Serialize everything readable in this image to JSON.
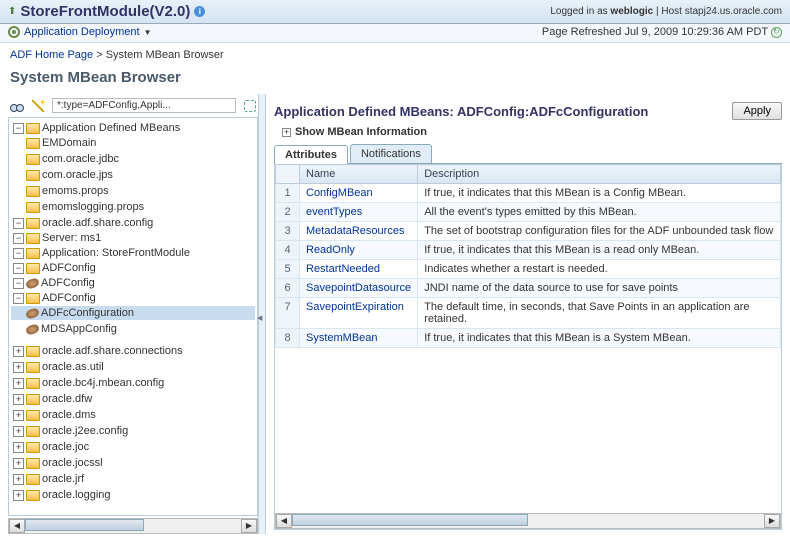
{
  "header": {
    "up_icon": "up-arrow",
    "title": "StoreFrontModule(V2.0)",
    "login_label": "Logged in as",
    "login_user": "weblogic",
    "host_label": "Host",
    "host_value": "stapj24.us.oracle.com",
    "deploy_menu": "Application Deployment",
    "refresh_label": "Page Refreshed",
    "refresh_time": "Jul 9, 2009 10:29:36 AM PDT"
  },
  "breadcrumb": {
    "home": "ADF Home Page",
    "sep": ">",
    "current": "System MBean Browser"
  },
  "page_title": "System MBean Browser",
  "toolbar": {
    "path": "*:type=ADFConfig,Appli..."
  },
  "tree": {
    "root": "Application Defined MBeans",
    "n_emdomain": "EMDomain",
    "n_oraclejdbc": "com.oracle.jdbc",
    "n_oraclejps": "com.oracle.jps",
    "n_emomsprops": "emoms.props",
    "n_emomslog": "emomslogging.props",
    "n_shareconfig": "oracle.adf.share.config",
    "n_server": "Server: ms1",
    "n_app": "Application: StoreFrontModule",
    "n_adfconfig": "ADFConfig",
    "n_adfconfig_bean": "ADFConfig",
    "n_adfconfig_sub": "ADFConfig",
    "n_adfcconfig": "ADFcConfiguration",
    "n_mds": "MDSAppConfig",
    "n_shareconn": "oracle.adf.share.connections",
    "n_asutil": "oracle.as.util",
    "n_bc4j": "oracle.bc4j.mbean.config",
    "n_dfw": "oracle.dfw",
    "n_dms": "oracle.dms",
    "n_j2ee": "oracle.j2ee.config",
    "n_joc": "oracle.joc",
    "n_jocssl": "oracle.jocssl",
    "n_jrf": "oracle.jrf",
    "n_logging": "oracle.logging"
  },
  "right": {
    "title": "Application Defined MBeans: ADFConfig:ADFcConfiguration",
    "apply": "Apply",
    "show_info": "Show MBean Information",
    "tab_attr": "Attributes",
    "tab_notif": "Notifications"
  },
  "table": {
    "col_name": "Name",
    "col_desc": "Description",
    "rows": [
      {
        "n": "1",
        "name": "ConfigMBean",
        "desc": "If true, it indicates that this MBean is a Config MBean."
      },
      {
        "n": "2",
        "name": "eventTypes",
        "desc": "All the event's types emitted by this MBean."
      },
      {
        "n": "3",
        "name": "MetadataResources",
        "desc": "The set of bootstrap configuration files for the ADF unbounded task flow"
      },
      {
        "n": "4",
        "name": "ReadOnly",
        "desc": "If true, it indicates that this MBean is a read only MBean."
      },
      {
        "n": "5",
        "name": "RestartNeeded",
        "desc": "Indicates whether a restart is needed."
      },
      {
        "n": "6",
        "name": "SavepointDatasource",
        "desc": "JNDI name of the data source to use for save points"
      },
      {
        "n": "7",
        "name": "SavepointExpiration",
        "desc": "The default time, in seconds, that Save Points in an application are retained."
      },
      {
        "n": "8",
        "name": "SystemMBean",
        "desc": "If true, it indicates that this MBean is a System MBean."
      }
    ]
  }
}
